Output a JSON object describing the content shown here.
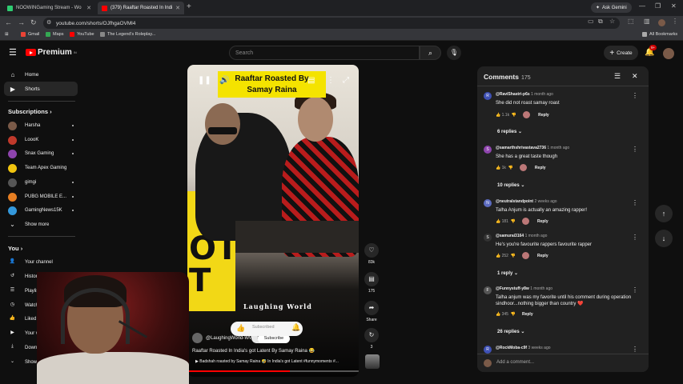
{
  "browser": {
    "tabs": [
      {
        "title": "NOOWINGaming Stream - Wo",
        "color": "#2ecc71"
      },
      {
        "title": "(379) Raaftar Roasted In Indi",
        "color": "#ff0000"
      }
    ],
    "new_tab": "+",
    "ask_gemini": "Ask Gemini",
    "url": "youtube.com/shorts/OJfhgaOVMl4",
    "bookmarks": [
      {
        "label": "Gmail",
        "color": "#ea4335"
      },
      {
        "label": "Maps",
        "color": "#34a853"
      },
      {
        "label": "YouTube",
        "color": "#ff0000"
      },
      {
        "label": "The Legend's Roleplay...",
        "color": "#888888"
      }
    ],
    "all_bookmarks": "All Bookmarks"
  },
  "masthead": {
    "logo": "Premium",
    "logo_sup": "IN",
    "search_placeholder": "Search",
    "create": "Create",
    "notif_count": "9+"
  },
  "sidebar": {
    "main": [
      {
        "label": "Home",
        "icon": "home-icon"
      },
      {
        "label": "Shorts",
        "icon": "shorts-icon"
      }
    ],
    "subs_heading": "Subscriptions",
    "subscriptions": [
      {
        "label": "Harsha",
        "color": "#7a5a48"
      },
      {
        "label": "LoooK",
        "color": "#c0392b"
      },
      {
        "label": "Snax Gaming",
        "color": "#8e44ad"
      },
      {
        "label": "Team Apex Gaming",
        "color": "#f1c40f"
      },
      {
        "label": "gimgi",
        "color": "#555555"
      },
      {
        "label": "PUBG MOBILE E...",
        "color": "#e67e22"
      },
      {
        "label": "GamingNews15K",
        "color": "#3498db"
      }
    ],
    "show_more": "Show more",
    "you_heading": "You",
    "you_items": [
      {
        "label": "Your channel"
      },
      {
        "label": "History"
      },
      {
        "label": "Playlists"
      },
      {
        "label": "Watch Later"
      },
      {
        "label": "Liked videos"
      },
      {
        "label": "Your videos"
      },
      {
        "label": "Downloads"
      },
      {
        "label": "Show more"
      }
    ]
  },
  "short": {
    "title_card_line1": "Raaftar Roasted By",
    "title_card_line2": "Samay Raina",
    "watermark": "Laughing World",
    "sign_text": "OT\nT",
    "channel": "@LaughingWorld-WW",
    "subscribed": "Subscribed",
    "subscribe_popup": "Subscribe",
    "title": "Raaftar Roasted In India's got Latent By Samay Raina 😂",
    "song": "▶ Badshah roasted by Samay Raina 🤣 In India's got Latent #funnymoments #...",
    "progress": 0.6
  },
  "actions": {
    "likes": "83k",
    "comments": "175",
    "share": "Share",
    "remix": "3"
  },
  "comments": {
    "header": "Comments",
    "count": "175",
    "add_placeholder": "Add a comment...",
    "items": [
      {
        "user": "@RaviShastri-p6s",
        "time": "1 month ago",
        "text": "She did not roast samay roast",
        "likes": "1.1k",
        "replies": "6 replies",
        "initial": "R",
        "color": "#3f51b5"
      },
      {
        "user": "@samarthshrivastava2736",
        "time": "1 month ago",
        "text": "She has a great taste though",
        "likes": "1k",
        "replies": "10 replies",
        "initial": "S",
        "color": "#8e44ad"
      },
      {
        "user": "@neutralstandpoint",
        "time": "2 weeks ago",
        "text": "Talha Anjum is actually an amazing rapper!",
        "likes": "181",
        "replies": "",
        "initial": "N",
        "color": "#5c6bc0"
      },
      {
        "user": "@samurai3164",
        "time": "1 month ago",
        "text": "He's you're favourite rappers favourite rapper",
        "likes": "252",
        "replies": "1 reply",
        "initial": "S",
        "color": "#333333"
      },
      {
        "user": "@Funnystuff-y8w",
        "time": "1 month ago",
        "text": "Talha anjum was my favorite until his comment during operation sindhoor...nothing bigger than country ❤️",
        "likes": "345",
        "replies": "26 replies",
        "initial": "F",
        "color": "#555555"
      },
      {
        "user": "@RockMoba-c9f",
        "time": "3 weeks ago",
        "text": "",
        "likes": "",
        "replies": "",
        "initial": "R",
        "color": "#3f51b5"
      }
    ],
    "reply": "Reply"
  }
}
